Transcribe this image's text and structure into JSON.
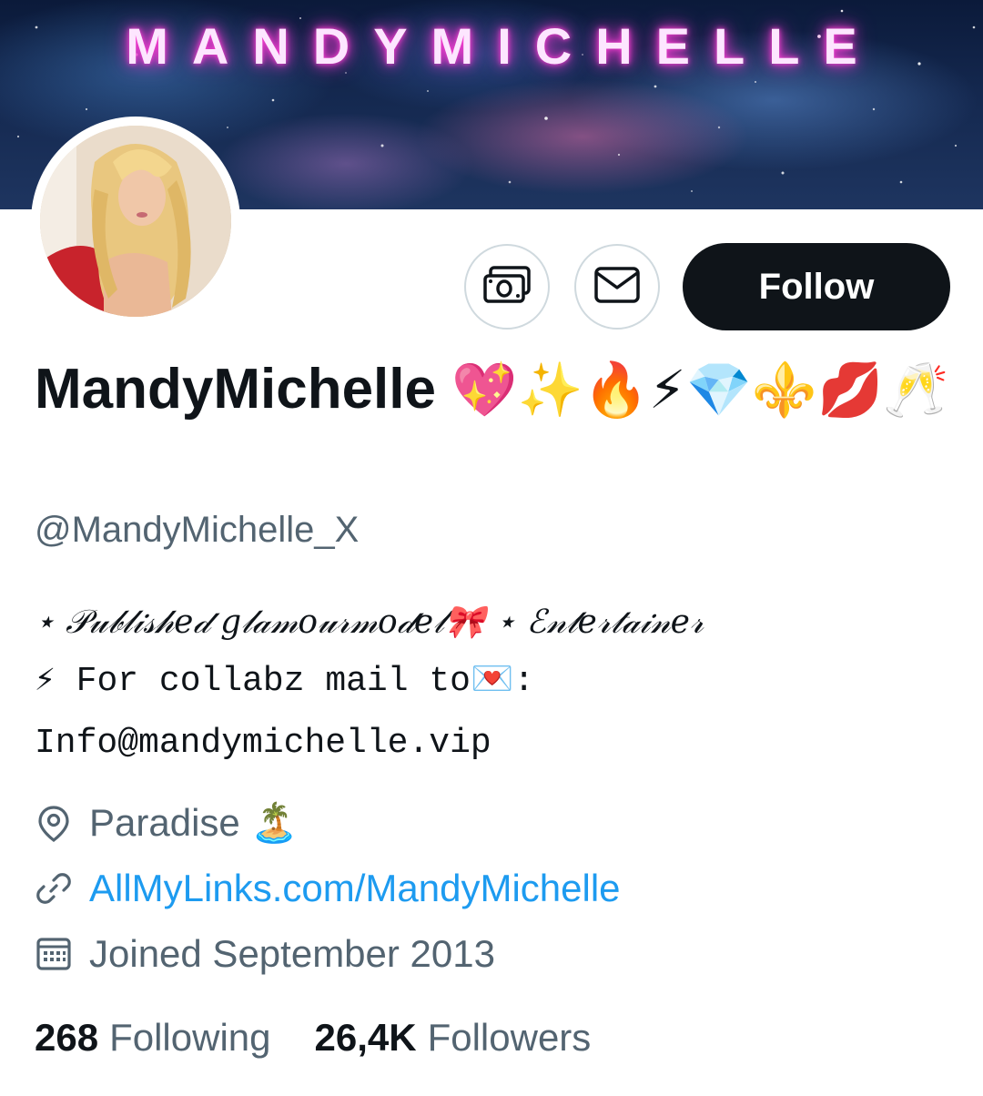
{
  "banner": {
    "title": "MANDYMICHELLE"
  },
  "actions": {
    "follow_label": "Follow",
    "tip_icon": "money-icon",
    "message_icon": "mail-icon"
  },
  "profile": {
    "display_name": "MandyMichelle",
    "name_emojis": "💖✨🔥⚡💎⚜️💋🥂",
    "handle": "@MandyMichelle_X"
  },
  "bio": {
    "line1": "⋆ 𝒫𝓊𝒷𝓁𝒾𝓈𝒽𝑒𝒹 𝑔𝓁𝒶𝓂𝑜𝓊𝓇𝓂𝑜𝒹𝑒𝓁🎀 ⋆ ℰ𝓃𝓉𝑒𝓇𝓉𝒶𝒾𝓃𝑒𝓇",
    "line2": "⚡ For collabz mail to💌:",
    "line3": "Info@mandymichelle.vip"
  },
  "meta": {
    "location": "Paradise 🏝️",
    "location_icon": "location-pin-icon",
    "link": "AllMyLinks.com/MandyMichelle",
    "link_icon": "link-icon",
    "joined": "Joined September 2013",
    "joined_icon": "calendar-icon"
  },
  "stats": {
    "following_count": "268",
    "following_label": "Following",
    "followers_count": "26,4K",
    "followers_label": "Followers"
  },
  "colors": {
    "accent": "#1d9bf0",
    "text_primary": "#0f1419",
    "text_secondary": "#536471",
    "border": "#cfd9de",
    "neon": "#ff3fd2"
  }
}
